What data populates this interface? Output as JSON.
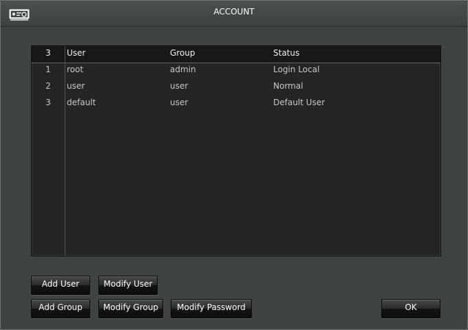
{
  "window": {
    "title": "ACCOUNT"
  },
  "table": {
    "header": {
      "count": "3",
      "user": "User",
      "group": "Group",
      "status": "Status"
    },
    "rows": [
      {
        "index": "1",
        "user": "root",
        "group": "admin",
        "status": "Login Local"
      },
      {
        "index": "2",
        "user": "user",
        "group": "user",
        "status": "Normal"
      },
      {
        "index": "3",
        "user": "default",
        "group": "user",
        "status": "Default User"
      }
    ]
  },
  "buttons": {
    "add_user": "Add User",
    "modify_user": "Modify User",
    "add_group": "Add Group",
    "modify_group": "Modify Group",
    "modify_password": "Modify Password",
    "ok": "OK"
  },
  "icons": {
    "app": "account-icon"
  }
}
